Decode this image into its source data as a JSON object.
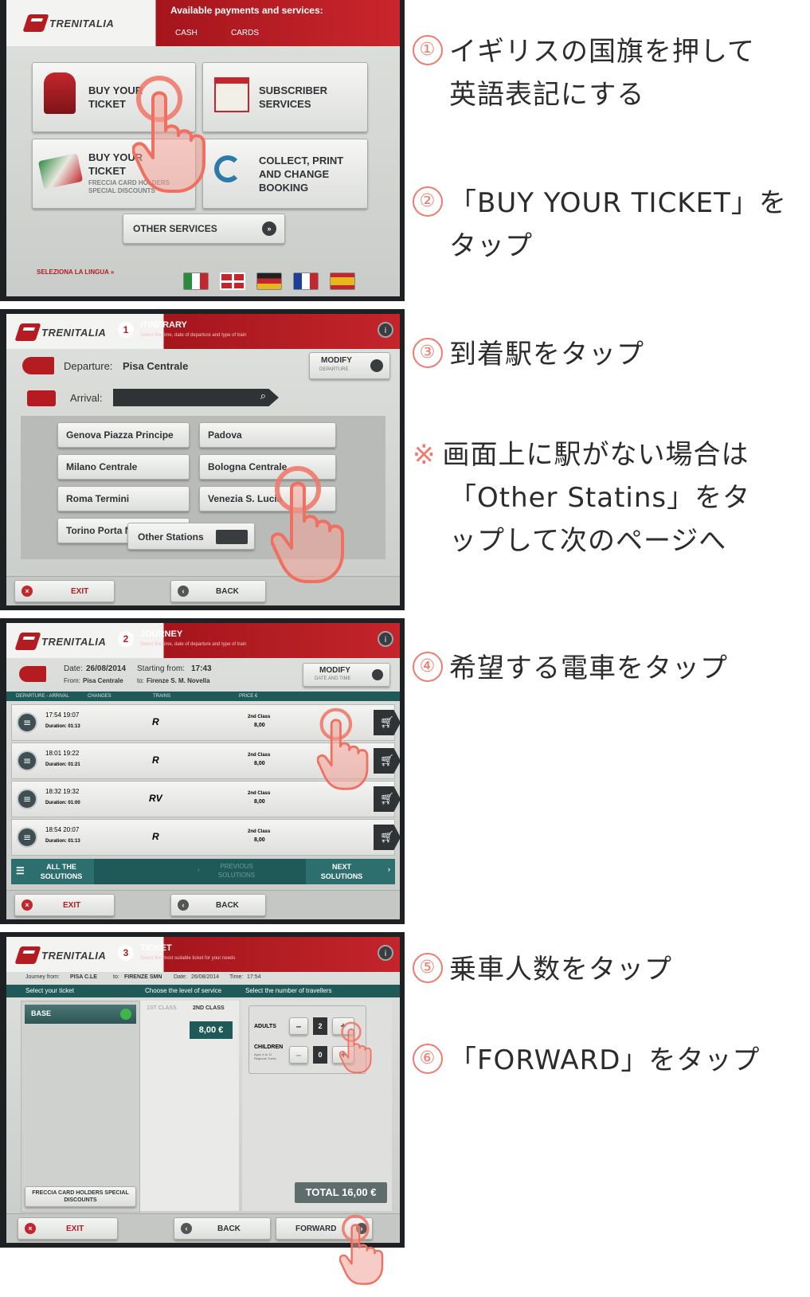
{
  "screen1": {
    "logo": "TRENITALIA",
    "services_title": "Available payments and services:",
    "cash": "CASH",
    "cards": "CARDS",
    "buy_ticket": "BUY YOUR TICKET",
    "subscriber": "SUBSCRIBER SERVICES",
    "buy_ticket_freccia": "BUY YOUR TICKET",
    "freccia_sub": "FRECCIA CARD HOLDERS SPECIAL DISCOUNTS",
    "collect": "COLLECT, PRINT AND CHANGE BOOKING",
    "other_services": "OTHER SERVICES",
    "seleziona": "SELEZIONA LA LINGUA »"
  },
  "screen2": {
    "logo": "TRENITALIA",
    "step": "1",
    "title": "ITINERARY",
    "subtitle": "Select the time, date of departure and type of train",
    "departure_label": "Departure:",
    "departure_value": "Pisa Centrale",
    "modify": "MODIFY",
    "modify_sub": "DEPARTURE",
    "arrival_label": "Arrival:",
    "stations": [
      "Genova Piazza Principe",
      "Padova",
      "Milano Centrale",
      "Bologna Centrale",
      "Roma Termini",
      "Venezia S. Lucia",
      "Torino Porta Nuova"
    ],
    "other_stations": "Other Stations",
    "exit": "EXIT",
    "back": "BACK"
  },
  "screen3": {
    "logo": "TRENITALIA",
    "step": "2",
    "title": "JOURNEY",
    "subtitle": "Select the time, date of departure and type of train",
    "date_label": "Date:",
    "date_value": "26/08/2014",
    "starting_label": "Starting from:",
    "starting_value": "17:43",
    "from_label": "From:",
    "from_value": "Pisa Centrale",
    "to_label": "to:",
    "to_value": "Firenze S. M. Novella",
    "modify": "MODIFY",
    "modify_sub": "DATE AND TIME",
    "col_departure": "DEPARTURE - ARRIVAL",
    "col_changes": "CHANGES",
    "col_trains": "TRAINS",
    "col_price": "PRICE €",
    "rows": [
      {
        "times": "17:54  19:07",
        "duration": "Duration: 01:13",
        "train": "R",
        "cls": "2nd Class",
        "price": "8,00"
      },
      {
        "times": "18:01  19:22",
        "duration": "Duration: 01:21",
        "train": "R",
        "cls": "2nd Class",
        "price": "8,00"
      },
      {
        "times": "18:32  19:32",
        "duration": "Duration: 01:00",
        "train": "RV",
        "cls": "2nd Class",
        "price": "8,00"
      },
      {
        "times": "18:54  20:07",
        "duration": "Duration: 01:13",
        "train": "R",
        "cls": "2nd Class",
        "price": "8,00"
      }
    ],
    "all_solutions": "ALL THE SOLUTIONS",
    "previous": "PREVIOUS SOLUTIONS",
    "next": "NEXT SOLUTIONS",
    "exit": "EXIT",
    "back": "BACK"
  },
  "screen4": {
    "logo": "TRENITALIA",
    "step": "3",
    "title": "TICKET",
    "subtitle": "Select the most suitable ticket for your needs",
    "journey_from_label": "Journey from:",
    "journey_from": "PISA C.LE",
    "to_label": "to:",
    "to": "FIRENZE SMN",
    "date_label": "Date:",
    "date": "26/08/2014",
    "time_label": "Time:",
    "time": "17:54",
    "select_ticket": "Select your ticket",
    "choose_level": "Choose the level of service",
    "select_number": "Select the number of travellers",
    "base": "BASE",
    "first_class": "1ST CLASS",
    "second_class": "2ND CLASS",
    "price": "8,00 €",
    "adults": "ADULTS",
    "adults_count": "2",
    "children": "CHILDREN",
    "children_sub": "Ages 4 to 11\nRegional Trains",
    "children_count": "0",
    "minus": "–",
    "plus": "+",
    "freccia": "FRECCIA CARD HOLDERS SPECIAL DISCOUNTS",
    "total": "TOTAL 16,00 €",
    "exit": "EXIT",
    "back": "BACK",
    "forward": "FORWARD"
  },
  "annotations": {
    "a1_num": "①",
    "a1_line1": "イギリスの国旗を押して",
    "a1_line2": "英語表記にする",
    "a2_num": "②",
    "a2_line1": "「BUY YOUR TICKET」を",
    "a2_line2": "タップ",
    "a3_num": "③",
    "a3_line1": "到着駅をタップ",
    "note_mark": "※",
    "note_line1": "画面上に駅がない場合は",
    "note_line2": "「Other Statins」をタ",
    "note_line3": "ップして次のページへ",
    "a4_num": "④",
    "a4_line1": "希望する電車をタップ",
    "a5_num": "⑤",
    "a5_line1": "乗車人数をタップ",
    "a6_num": "⑥",
    "a6_line1": "「FORWARD」をタップ"
  },
  "colors": {
    "accent": "#b41c22",
    "annotation": "#ef7b6f",
    "teal": "#1f5a59"
  }
}
